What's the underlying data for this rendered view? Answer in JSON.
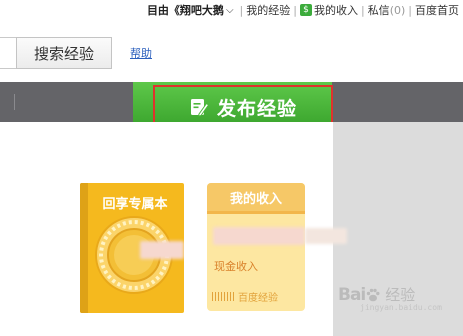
{
  "topnav": {
    "user": "目由《翔吧大鹅",
    "items": [
      "我的经验",
      "我的收入",
      "私信",
      "百度首页"
    ],
    "message_count": "(0)",
    "money_icon_glyph": "$",
    "icons": [
      "chevron-down-icon",
      "money-icon"
    ]
  },
  "search": {
    "button_label": "搜索经验",
    "help_link": "帮助"
  },
  "nav": {
    "publish_label": "发布经验",
    "publish_icon": "edit-icon",
    "bar_color": "#646468",
    "accent_color": "#4cb83a",
    "highlight_color": "#e0322d"
  },
  "cards": {
    "book": {
      "title": "回享专属本",
      "color": "#f5b91e",
      "icon": "medal-icon"
    },
    "income": {
      "title": "我的收入",
      "subtitle": "现金收入",
      "footer": "百度经验",
      "color": "#fde7a1",
      "icon": "barcode-icon"
    }
  },
  "watermark": {
    "text_latin": "Bai",
    "text_cn": "经验",
    "url": "jingyan.baidu.com",
    "icon": "paw-icon"
  }
}
